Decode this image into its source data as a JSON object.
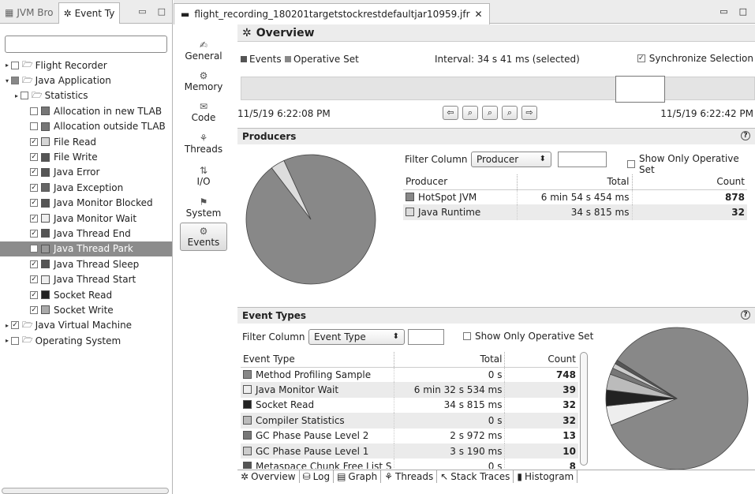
{
  "left_panel": {
    "tabs": [
      {
        "label": "JVM Bro",
        "icon": "jvm-browser-icon"
      },
      {
        "label": "Event Ty",
        "icon": "event-types-icon"
      }
    ],
    "tree": [
      {
        "label": "Flight Recorder",
        "level": 0,
        "arrow": "▸",
        "checked": false,
        "folder": true
      },
      {
        "label": "Java Application",
        "level": 0,
        "arrow": "▾",
        "checked": "partial",
        "folder": true
      },
      {
        "label": "Statistics",
        "level": 1,
        "arrow": "▸",
        "checked": false,
        "folder": true
      },
      {
        "label": "Allocation in new TLAB",
        "level": 2,
        "checked": false,
        "color": "#777777"
      },
      {
        "label": "Allocation outside TLAB",
        "level": 2,
        "checked": false,
        "color": "#777777"
      },
      {
        "label": "File Read",
        "level": 2,
        "checked": true,
        "color": "#d6d6d6"
      },
      {
        "label": "File Write",
        "level": 2,
        "checked": true,
        "color": "#555555"
      },
      {
        "label": "Java Error",
        "level": 2,
        "checked": true,
        "color": "#555555"
      },
      {
        "label": "Java Exception",
        "level": 2,
        "checked": true,
        "color": "#666666"
      },
      {
        "label": "Java Monitor Blocked",
        "level": 2,
        "checked": true,
        "color": "#555555"
      },
      {
        "label": "Java Monitor Wait",
        "level": 2,
        "checked": true,
        "color": "#eeeeee"
      },
      {
        "label": "Java Thread End",
        "level": 2,
        "checked": true,
        "color": "#555555"
      },
      {
        "label": "Java Thread Park",
        "level": 2,
        "checked": false,
        "color": "#999999",
        "selected": true
      },
      {
        "label": "Java Thread Sleep",
        "level": 2,
        "checked": true,
        "color": "#555555"
      },
      {
        "label": "Java Thread Start",
        "level": 2,
        "checked": true,
        "color": "#eeeeee"
      },
      {
        "label": "Socket Read",
        "level": 2,
        "checked": true,
        "color": "#222222"
      },
      {
        "label": "Socket Write",
        "level": 2,
        "checked": true,
        "color": "#aaaaaa"
      },
      {
        "label": "Java Virtual Machine",
        "level": 0,
        "arrow": "▸",
        "checked": true,
        "folder": true
      },
      {
        "label": "Operating System",
        "level": 0,
        "arrow": "▸",
        "checked": false,
        "folder": true
      }
    ]
  },
  "editor": {
    "tab_title": "flight_recording_180201targetstockrestdefaultjar10959.jfr",
    "nav": [
      {
        "label": "General",
        "icon": "general-icon"
      },
      {
        "label": "Memory",
        "icon": "memory-icon"
      },
      {
        "label": "Code",
        "icon": "code-icon"
      },
      {
        "label": "Threads",
        "icon": "threads-icon"
      },
      {
        "label": "I/O",
        "icon": "io-icon"
      },
      {
        "label": "System",
        "icon": "system-icon"
      },
      {
        "label": "Events",
        "icon": "events-icon",
        "active": true
      }
    ],
    "overview_title": "Overview",
    "legend_events": "Events",
    "legend_operative": "Operative Set",
    "interval": "Interval: 34 s 41 ms (selected)",
    "sync_label": "Synchronize Selection",
    "time_start": "11/5/19 6:22:08 PM",
    "time_end": "11/5/19 6:22:42 PM"
  },
  "producers": {
    "title": "Producers",
    "filter_label": "Filter Column",
    "filter_value": "Producer",
    "show_only": "Show Only Operative Set",
    "columns": [
      "Producer",
      "Total",
      "Count"
    ],
    "rows": [
      {
        "name": "HotSpot JVM",
        "total": "6 min 54 s 454 ms",
        "count": "878",
        "color": "#888888"
      },
      {
        "name": "Java Runtime",
        "total": "34 s 815 ms",
        "count": "32",
        "color": "#dddddd"
      }
    ]
  },
  "event_types": {
    "title": "Event Types",
    "filter_label": "Filter Column",
    "filter_value": "Event Type",
    "show_only": "Show Only Operative Set",
    "columns": [
      "Event Type",
      "Total",
      "Count"
    ],
    "rows": [
      {
        "name": "Method Profiling Sample",
        "total": "0 s",
        "count": "748",
        "color": "#888888"
      },
      {
        "name": "Java Monitor Wait",
        "total": "6 min 32 s 534 ms",
        "count": "39",
        "color": "#eeeeee"
      },
      {
        "name": "Socket Read",
        "total": "34 s 815 ms",
        "count": "32",
        "color": "#222222"
      },
      {
        "name": "Compiler Statistics",
        "total": "0 s",
        "count": "32",
        "color": "#bbbbbb"
      },
      {
        "name": "GC Phase Pause Level 2",
        "total": "2 s 972 ms",
        "count": "13",
        "color": "#777777"
      },
      {
        "name": "GC Phase Pause Level 1",
        "total": "3 s 190 ms",
        "count": "10",
        "color": "#cccccc"
      },
      {
        "name": "Metaspace Chunk Free List S",
        "total": "0 s",
        "count": "8",
        "color": "#555555"
      }
    ]
  },
  "bottom_tabs": [
    {
      "label": "Overview",
      "icon": "overview-icon"
    },
    {
      "label": "Log",
      "icon": "log-icon"
    },
    {
      "label": "Graph",
      "icon": "graph-icon"
    },
    {
      "label": "Threads",
      "icon": "threads-tab-icon"
    },
    {
      "label": "Stack Traces",
      "icon": "stack-traces-icon"
    },
    {
      "label": "Histogram",
      "icon": "histogram-icon"
    }
  ],
  "chart_data": [
    {
      "type": "pie",
      "title": "",
      "labels": [
        "HotSpot JVM",
        "Java Runtime"
      ],
      "values": [
        878,
        32
      ],
      "colors": [
        "#888888",
        "#dddddd"
      ]
    },
    {
      "type": "pie",
      "title": "",
      "labels": [
        "Method Profiling Sample",
        "Java Monitor Wait",
        "Socket Read",
        "Compiler Statistics",
        "GC Phase Pause Level 2",
        "GC Phase Pause Level 1",
        "Metaspace Chunk Free List S"
      ],
      "values": [
        748,
        39,
        32,
        32,
        13,
        10,
        8
      ],
      "colors": [
        "#888888",
        "#eeeeee",
        "#222222",
        "#bbbbbb",
        "#777777",
        "#cccccc",
        "#555555"
      ]
    }
  ]
}
